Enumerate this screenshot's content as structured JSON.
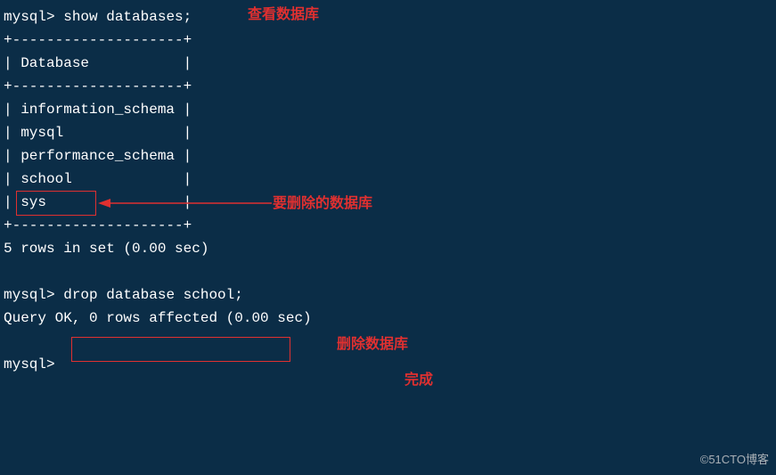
{
  "terminal": {
    "prompt": "mysql>",
    "cmd1": "show databases;",
    "table": {
      "border_top": "+--------------------+",
      "header_row": "| Database           |",
      "border_mid": "+--------------------+",
      "rows": [
        "| information_schema |",
        "| mysql              |",
        "| performance_schema |",
        "| school             |",
        "| sys                |"
      ],
      "border_bot": "+--------------------+"
    },
    "result1": "5 rows in set (0.00 sec)",
    "cmd2": "drop database school;",
    "result2": "Query OK, 0 rows affected (0.00 sec)"
  },
  "annotations": {
    "view_db": "查看数据库",
    "to_delete": "要删除的数据库",
    "delete_db": "删除数据库",
    "done": "完成"
  },
  "watermark": "©51CTO博客"
}
